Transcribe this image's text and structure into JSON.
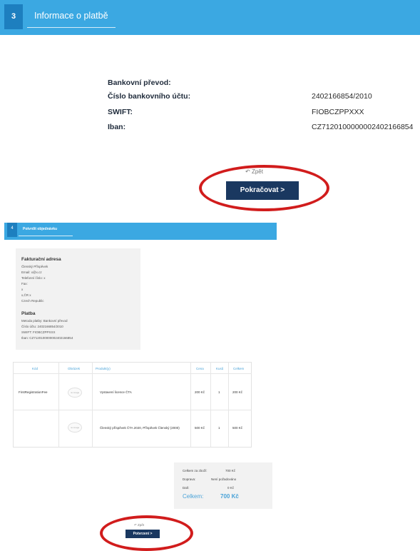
{
  "step3": {
    "number": "3",
    "title": "Informace o platbě"
  },
  "bank": {
    "heading": "Bankovní převod:",
    "rows": [
      {
        "label": "Číslo bankovního účtu:",
        "value": "2402166854/2010"
      },
      {
        "label": "SWIFT:",
        "value": "FIOBCZPPXXX"
      },
      {
        "label": "Iban:",
        "value": "CZ7120100000002402166854"
      }
    ]
  },
  "actions1": {
    "back_label": "Zpět",
    "back_icon": "undo-arrow-icon",
    "continue_label": "Pokračovat  >"
  },
  "step4": {
    "number": "4",
    "title": "Potvrdit objednávku"
  },
  "billing": {
    "heading": "Fakturační adresa",
    "lines": [
      "Členský Příspěvek",
      "Email: x@x.cz",
      "Telefonní číslo: x",
      "Fax:",
      "x",
      "x,ČR x",
      "Czech Republic"
    ],
    "payment_heading": "Platba",
    "payment_lines": [
      "Metoda platby: Bankovní převod",
      "Číslo účtu: 2402166854/2010",
      "SWIFT: FIOBCZPPXXX",
      "Iban: CZ7120100000002402166854"
    ]
  },
  "table": {
    "headers": [
      "Kód",
      "Obrázek",
      "Produkt(y)",
      "Cena",
      "Kusů",
      "Celkem"
    ],
    "image_placeholder": "no image",
    "rows": [
      {
        "code": "FirstRegistrationFee",
        "product": "Vystavení licence ČTA",
        "price": "200 Kč",
        "qty": "1",
        "total": "200 Kč"
      },
      {
        "code": "",
        "product": "Členský příspěvek ČTA 2020, Příspěvek Členský (2000)",
        "price": "500 Kč",
        "qty": "1",
        "total": "500 Kč"
      }
    ]
  },
  "totals": {
    "rows": [
      {
        "label": "Celkem za zboží:",
        "value": "700 Kč"
      },
      {
        "label": "Doprava:",
        "value": "Není požadováno"
      },
      {
        "label": "Daň:",
        "value": "0 Kč"
      }
    ],
    "grand_label": "Celkem:",
    "grand_value": "700 Kč"
  },
  "actions2": {
    "back_label": "Zpět",
    "confirm_label": "Potvrzení  >"
  },
  "colors": {
    "header_blue": "#3ba8e2",
    "button_navy": "#1a3860",
    "highlight_red": "#d11c1c"
  }
}
